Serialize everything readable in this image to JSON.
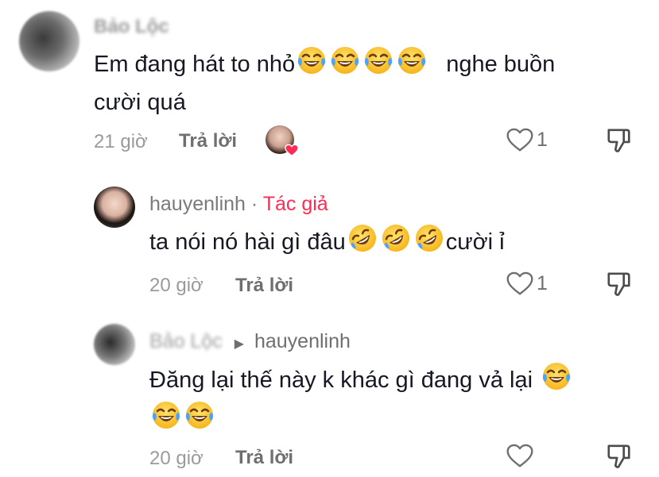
{
  "comment1": {
    "username": "Bảo Lộc",
    "text_before": "Em đang hát to nhỏ",
    "text_after": "nghe buồn",
    "text_line2": "cười quá",
    "emojis": [
      "joy-emoji",
      "joy-emoji",
      "joy-emoji",
      "joy-emoji"
    ],
    "time": "21 giờ",
    "reply_label": "Trả lời",
    "likes": "1"
  },
  "reply1": {
    "username": "hauyenlinh",
    "separator": "·",
    "author_badge": "Tác giả",
    "text_before": "ta nói nó hài gì đâu",
    "emojis": [
      "rofl-emoji",
      "rofl-emoji",
      "rofl-emoji"
    ],
    "text_after": "cười ỉ",
    "time": "20 giờ",
    "reply_label": "Trả lời",
    "likes": "1"
  },
  "reply2": {
    "username": "Bảo Lộc",
    "reply_to": "hauyenlinh",
    "text_line1": "Đăng lại thế này k khác gì đang vả lại",
    "emojis_line1": [
      "joy-emoji"
    ],
    "emojis_line2": [
      "joy-emoji",
      "joy-emoji"
    ],
    "time": "20 giờ",
    "reply_label": "Trả lời"
  },
  "colors": {
    "author_accent": "#fe2c55",
    "heart_badge": "#fe2c55"
  }
}
